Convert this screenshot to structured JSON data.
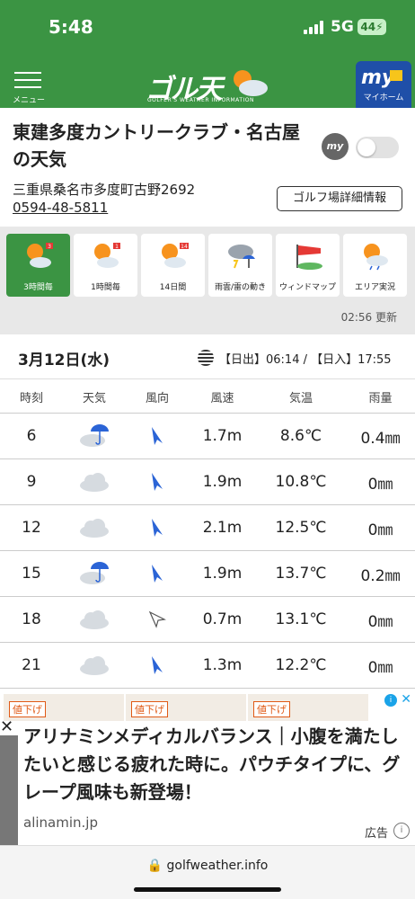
{
  "status_bar": {
    "time": "5:48",
    "network": "5G",
    "battery": "44"
  },
  "header": {
    "menu_label": "メニュー",
    "logo_text": "ゴル天",
    "logo_sub": "GOLFER'S WEATHER INFORMATION",
    "myhome_big": "my",
    "myhome_label": "マイホーム"
  },
  "club": {
    "name": "東建多度カントリークラブ・名古屋の天気",
    "my_badge": "my",
    "address": "三重県桑名市多度町古野2692",
    "phone": "0594-48-5811",
    "detail_button": "ゴルフ場詳細情報"
  },
  "tabs": [
    {
      "label": "3時間毎",
      "icon": "sun-cloud-golf-icon",
      "badge": "3"
    },
    {
      "label": "1時間毎",
      "icon": "sun-cloud-golf-icon",
      "badge": "1"
    },
    {
      "label": "14日間",
      "icon": "sun-cloud-golf-icon",
      "badge": "14"
    },
    {
      "label": "雨雲/雷の動き",
      "icon": "rain-thunder-icon"
    },
    {
      "label": "ウィンドマップ",
      "icon": "windsock-icon"
    },
    {
      "label": "エリア実況",
      "icon": "sun-cloud-rain-icon"
    }
  ],
  "updated": "02:56 更新",
  "date": "3月12日(水)",
  "sun_times": "【日出】06:14 / 【日入】17:55",
  "table": {
    "headers": [
      "時刻",
      "天気",
      "風向",
      "風速",
      "気温",
      "雨量"
    ],
    "rows": [
      {
        "time": "6",
        "weather": "cloud-umbrella-icon",
        "wind_dir": "arrow-n",
        "wind_speed": "1.7m",
        "temp": "8.6℃",
        "rain": "0.4㎜"
      },
      {
        "time": "9",
        "weather": "cloud-icon",
        "wind_dir": "arrow-n",
        "wind_speed": "1.9m",
        "temp": "10.8℃",
        "rain": "0㎜"
      },
      {
        "time": "12",
        "weather": "cloud-icon",
        "wind_dir": "arrow-n",
        "wind_speed": "2.1m",
        "temp": "12.5℃",
        "rain": "0㎜"
      },
      {
        "time": "15",
        "weather": "cloud-umbrella-icon",
        "wind_dir": "arrow-n",
        "wind_speed": "1.9m",
        "temp": "13.7℃",
        "rain": "0.2㎜"
      },
      {
        "time": "18",
        "weather": "cloud-icon",
        "wind_dir": "arrow-outline",
        "wind_speed": "0.7m",
        "temp": "13.1℃",
        "rain": "0㎜"
      },
      {
        "time": "21",
        "weather": "cloud-icon",
        "wind_dir": "arrow-n",
        "wind_speed": "1.3m",
        "temp": "12.2℃",
        "rain": "0㎜"
      }
    ]
  },
  "ad": {
    "tags": [
      "値下げ",
      "値下げ",
      "値下げ"
    ],
    "headline": "アリナミンメディカルバランス｜小腹を満たしたいと感じる疲れた時に。パウチタイプに、グレープ風味も新登場！",
    "domain": "alinamin.jp",
    "label": "広告"
  },
  "url": "golfweather.info",
  "colors": {
    "brand_green": "#3b9443",
    "myhome_blue": "#1f4fa8",
    "arrow_blue": "#2b64d6"
  }
}
